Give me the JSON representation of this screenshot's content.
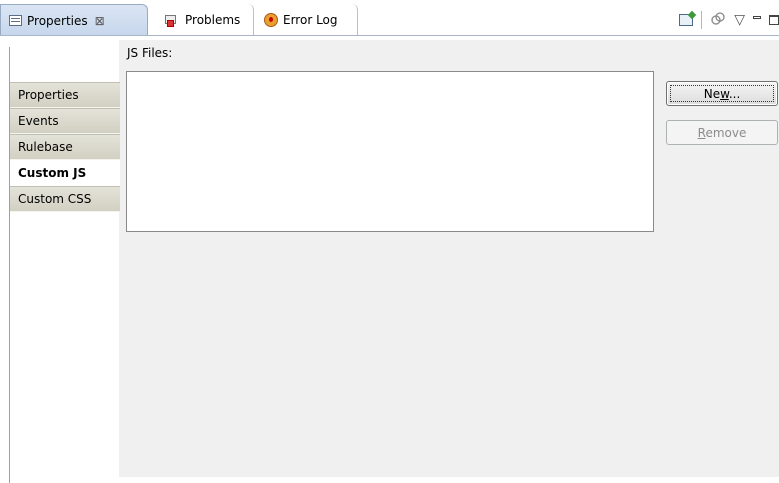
{
  "tabs": [
    {
      "label": "Properties",
      "close": "⊠",
      "active": true,
      "icon": "properties-view-icon"
    },
    {
      "label": "Problems",
      "active": false,
      "icon": "problems-view-icon"
    },
    {
      "label": "Error Log",
      "active": false,
      "icon": "error-log-icon"
    }
  ],
  "toolbar": {
    "icons": [
      "pin-view-icon",
      "filter-icon",
      "view-menu-icon",
      "minimize-icon",
      "maximize-icon"
    ],
    "menu_glyph": "▽"
  },
  "side_tabs": [
    {
      "label": "Properties",
      "selected": false
    },
    {
      "label": "Events",
      "selected": false
    },
    {
      "label": "Rulebase",
      "selected": false
    },
    {
      "label": "Custom JS",
      "selected": true
    },
    {
      "label": "Custom CSS",
      "selected": false
    }
  ],
  "main": {
    "list_label": "JS Files:",
    "new_button": {
      "pre": "Ne",
      "mnemonic": "w",
      "post": "..."
    },
    "remove_button": {
      "pre": "",
      "mnemonic": "R",
      "post": "emove"
    }
  },
  "colors": {
    "active_tab_bg": "#c6d6ec",
    "side_tab_bg": "#d2d0c2",
    "panel_bg": "#f0f0f0"
  }
}
